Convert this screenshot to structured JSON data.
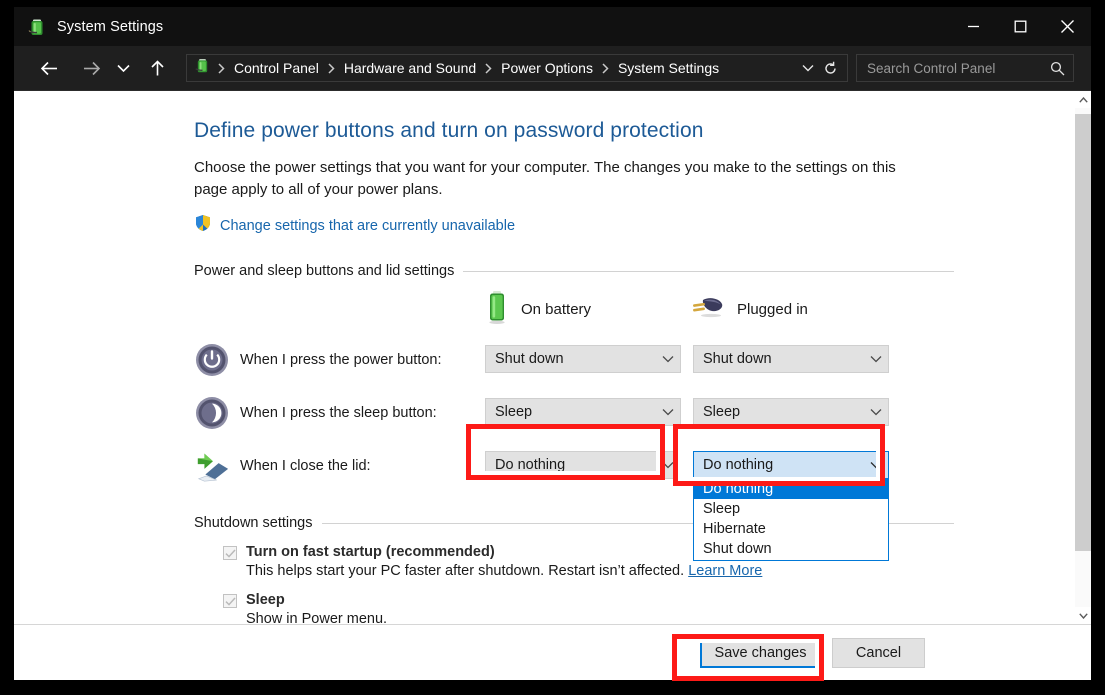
{
  "window": {
    "title": "System Settings",
    "title_icon": "battery-plug-icon",
    "minimize_label": "Minimize",
    "maximize_label": "Maximize",
    "close_label": "Close"
  },
  "addressbar": {
    "back_label": "Back",
    "forward_label": "Forward",
    "recent_label": "Recent locations",
    "up_label": "Up one level",
    "crumb_icon": "battery-plug-icon",
    "breadcrumbs": [
      {
        "label": "Control Panel"
      },
      {
        "label": "Hardware and Sound"
      },
      {
        "label": "Power Options"
      },
      {
        "label": "System Settings"
      }
    ],
    "dropdown_label": "Previous locations",
    "refresh_label": "Refresh",
    "search": {
      "placeholder": "Search Control Panel",
      "value": "",
      "icon": "search-icon"
    }
  },
  "page": {
    "title": "Define power buttons and turn on password protection",
    "description": "Choose the power settings that you want for your computer. The changes you make to the settings on this page apply to all of your power plans.",
    "uac_link": "Change settings that are currently unavailable",
    "uac_icon": "shield-icon"
  },
  "power_section": {
    "group_title": "Power and sleep buttons and lid settings",
    "columns": [
      {
        "label": "On battery",
        "icon": "battery-icon"
      },
      {
        "label": "Plugged in",
        "icon": "power-plug-icon"
      }
    ],
    "rows": [
      {
        "icon": "power-button-icon",
        "label": "When I press the power button:",
        "on_battery": "Shut down",
        "plugged_in": "Shut down"
      },
      {
        "icon": "sleep-button-icon",
        "label": "When I press the sleep button:",
        "on_battery": "Sleep",
        "plugged_in": "Sleep"
      },
      {
        "icon": "close-lid-icon",
        "label": "When I close the lid:",
        "on_battery": "Do nothing",
        "plugged_in": "Do nothing"
      }
    ],
    "open_dropdown": {
      "selected": "Do nothing",
      "options": [
        "Do nothing",
        "Sleep",
        "Hibernate",
        "Shut down"
      ],
      "highlighted_index": 0
    }
  },
  "shutdown_section": {
    "group_title": "Shutdown settings",
    "items": [
      {
        "label": "Turn on fast startup (recommended)",
        "checked": true,
        "enabled": false,
        "description_before": "This helps start your PC faster after shutdown. Restart isn’t affected. ",
        "link_text": "Learn More"
      },
      {
        "label": "Sleep",
        "checked": true,
        "enabled": false,
        "description_before": "Show in Power menu.",
        "link_text": ""
      }
    ]
  },
  "footer": {
    "save_label": "Save changes",
    "cancel_label": "Cancel"
  },
  "scrollbar": {
    "up_label": "Scroll up",
    "down_label": "Scroll down",
    "thumb_label": "Vertical scroll thumb"
  },
  "annotations": {
    "color": "#fd1a17",
    "highlight_on_battery_lid": "Do nothing",
    "highlight_plugged_lid": "Do nothing",
    "highlight_save": "Save changes"
  }
}
